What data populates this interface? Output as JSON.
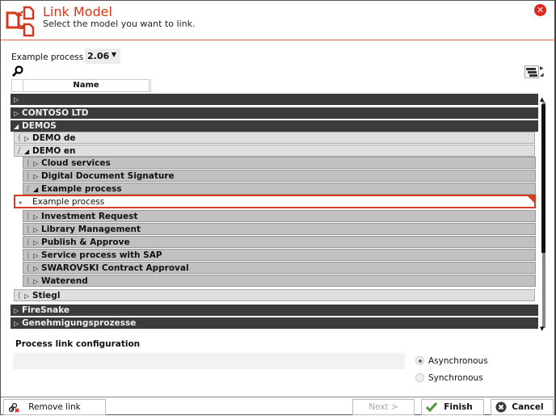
{
  "dialog": {
    "title": "Link Model",
    "subtitle": "Select the model you want to link.",
    "close_icon": "close-circle-icon"
  },
  "version": {
    "label": "Example process",
    "selected": "2.06"
  },
  "grid": {
    "column_header": "Name"
  },
  "tree": {
    "rows": [
      {
        "label": "",
        "level": 0,
        "state": "collapsed"
      },
      {
        "label": "CONTOSO LTD",
        "level": 0,
        "state": "collapsed"
      },
      {
        "label": "DEMOS",
        "level": 0,
        "state": "expanded"
      },
      {
        "label": "DEMO de",
        "level": 1,
        "state": "collapsed"
      },
      {
        "label": "DEMO en",
        "level": 1,
        "state": "expanded"
      },
      {
        "label": "Cloud services",
        "level": 2,
        "state": "collapsed"
      },
      {
        "label": "Digital Document Signature",
        "level": 2,
        "state": "collapsed"
      },
      {
        "label": "Example process",
        "level": 2,
        "state": "expanded"
      },
      {
        "label": "Example process",
        "level": 3,
        "state": "selected"
      },
      {
        "label": "Investment Request",
        "level": 2,
        "state": "collapsed"
      },
      {
        "label": "Library Management",
        "level": 2,
        "state": "collapsed"
      },
      {
        "label": "Publish & Approve",
        "level": 2,
        "state": "collapsed"
      },
      {
        "label": "Service process with SAP",
        "level": 2,
        "state": "collapsed"
      },
      {
        "label": "SWAROVSKI Contract Approval",
        "level": 2,
        "state": "collapsed"
      },
      {
        "label": "Waterend",
        "level": 2,
        "state": "collapsed"
      },
      {
        "label": "Stiegl",
        "level": 1,
        "state": "collapsed"
      },
      {
        "label": "FireSnake",
        "level": 0,
        "state": "collapsed"
      },
      {
        "label": "Genehmigungsprozesse",
        "level": 0,
        "state": "collapsed"
      }
    ]
  },
  "config": {
    "title": "Process link configuration",
    "field_value": "",
    "options": [
      {
        "label": "Asynchronous",
        "selected": true
      },
      {
        "label": "Synchronous",
        "selected": false
      }
    ]
  },
  "footer": {
    "remove_link": "Remove link",
    "next": "Next >",
    "finish": "Finish",
    "cancel": "Cancel"
  },
  "colors": {
    "accent": "#d23a1e",
    "header_row": "#3b3b3b",
    "level1_row": "#dedede",
    "level2_row": "#c1c1c1"
  }
}
